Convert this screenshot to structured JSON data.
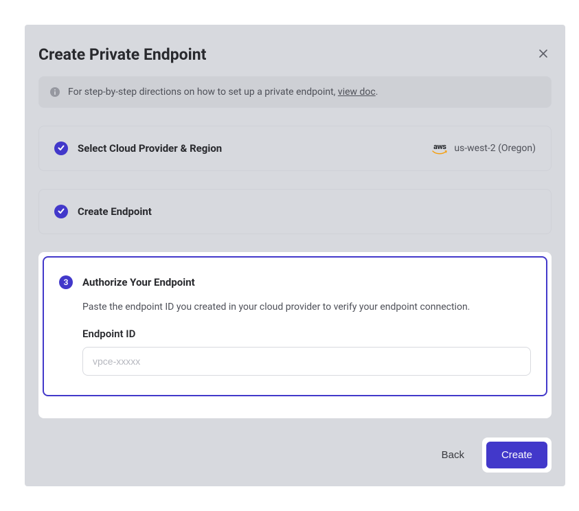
{
  "modal": {
    "title": "Create Private Endpoint",
    "info_banner": {
      "text_prefix": "For step-by-step directions on how to set up a private endpoint, ",
      "link_text": "view doc",
      "text_suffix": "."
    }
  },
  "steps": {
    "step1": {
      "title": "Select Cloud Provider & Region",
      "provider_label": "aws",
      "region": "us-west-2 (Oregon)"
    },
    "step2": {
      "title": "Create Endpoint"
    },
    "step3": {
      "number": "3",
      "title": "Authorize Your Endpoint",
      "description": "Paste the endpoint ID you created in your cloud provider to verify your endpoint connection.",
      "field_label": "Endpoint ID",
      "placeholder": "vpce-xxxxx",
      "value": ""
    }
  },
  "footer": {
    "back_label": "Back",
    "create_label": "Create"
  },
  "colors": {
    "accent": "#4238ca",
    "overlay": "#d7d9de"
  }
}
